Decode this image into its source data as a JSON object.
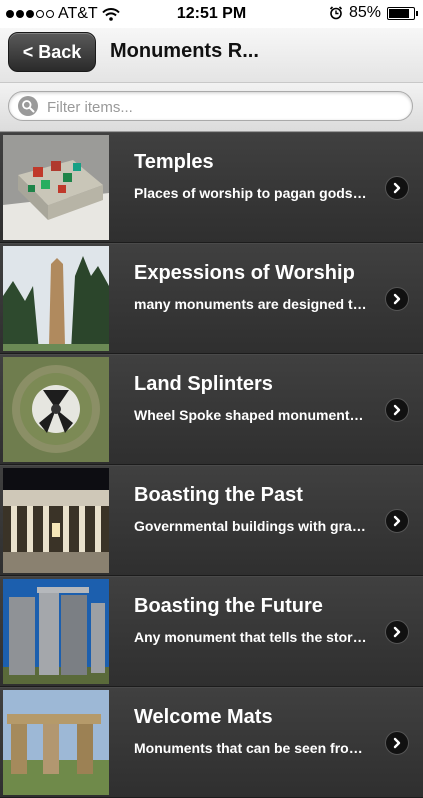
{
  "status_bar": {
    "carrier": "AT&T",
    "time": "12:51 PM",
    "battery_percent": "85%",
    "battery_level": 0.85,
    "signal_strength": 3,
    "signal_max": 5,
    "icons": [
      "wifi-icon",
      "alarm-icon",
      "battery-icon"
    ]
  },
  "nav": {
    "back_label": "< Back",
    "title": "Monuments R..."
  },
  "search": {
    "placeholder": "Filter items..."
  },
  "items": [
    {
      "title": "Temples",
      "subtitle": "Places of worship to pagan gods and goddesses"
    },
    {
      "title": "Expessions of Worship",
      "subtitle": "many monuments are designed to honor"
    },
    {
      "title": "Land Splinters",
      "subtitle": "Wheel Spoke shaped monuments across the land"
    },
    {
      "title": "Boasting the Past",
      "subtitle": "Governmental buildings with grand columns"
    },
    {
      "title": "Boasting the Future",
      "subtitle": "Any monument that tells the story of the future"
    },
    {
      "title": "Welcome Mats",
      "subtitle": "Monuments that can be seen from above"
    }
  ],
  "colors": {
    "row_bg": "#3a3a3a",
    "nav_bg": "#ececec",
    "text_light": "#ffffff"
  }
}
